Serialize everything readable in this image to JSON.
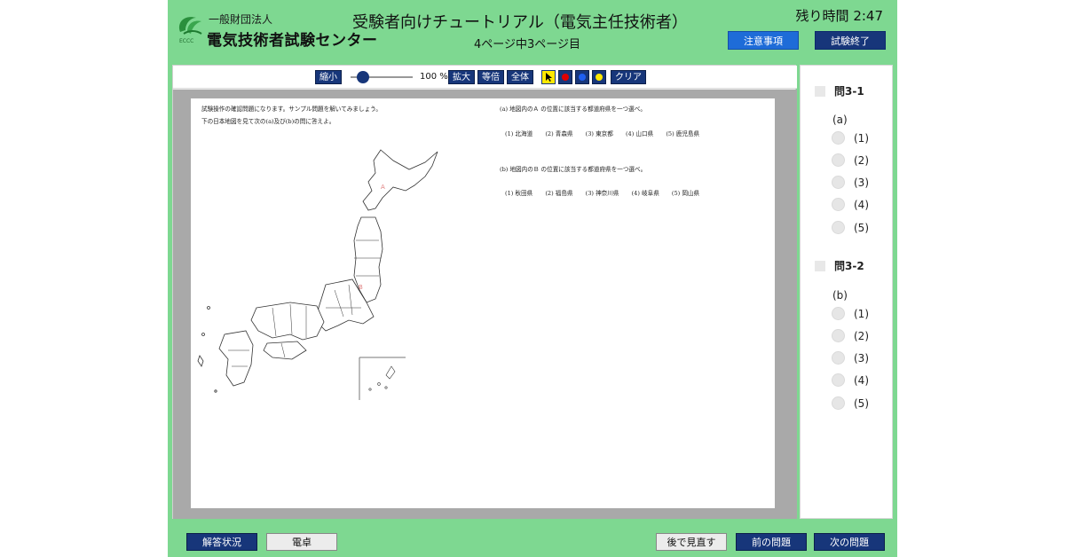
{
  "header": {
    "org_small": "一般財団法人",
    "org_large": "電気技術者試験センター",
    "exam_title": "受験者向けチュートリアル（電気主任技術者）",
    "page_indicator": "4ページ中3ページ目",
    "time_remaining": "残り時間 2:47",
    "notes_button": "注意事項",
    "end_exam_button": "試験終了"
  },
  "toolbar": {
    "zoom_out": "縮小",
    "zoom_value": "100 %",
    "zoom_in": "拡大",
    "actual_size": "等倍",
    "fit_page": "全体",
    "clear": "クリア",
    "zoom_level_fraction": 0.2,
    "pen_colors": [
      "#e00000",
      "#1f5ff0",
      "#ffe800"
    ]
  },
  "document": {
    "intro_line1": "試験操作の確認問題になります。サンプル問題を解いてみましょう。",
    "intro_line2": "下の日本地図を見て次の(a)及び(b)の問に答えよ。",
    "q_a": "(a) 地図内のＡ の位置に該当する都道府県を一つ選べ。",
    "q_a_choices": [
      "(1) 北海道",
      "(2) 青森県",
      "(3) 東京都",
      "(4) 山口県",
      "(5) 鹿児島県"
    ],
    "q_b": "(b) 地図内のＢ の位置に該当する都道府県を一つ選べ。",
    "q_b_choices": [
      "(1) 秋田県",
      "(2) 福島県",
      "(3) 神奈川県",
      "(4) 岐阜県",
      "(5) 岡山県"
    ],
    "map_label_a": "A",
    "map_label_b": "B"
  },
  "answers": {
    "q1_title": "問3-1",
    "q1_sub": "(a)",
    "q1_options": [
      "(1)",
      "(2)",
      "(3)",
      "(4)",
      "(5)"
    ],
    "q2_title": "問3-2",
    "q2_sub": "(b)",
    "q2_options": [
      "(1)",
      "(2)",
      "(3)",
      "(4)",
      "(5)"
    ]
  },
  "footer": {
    "answer_status": "解答状況",
    "calculator": "電卓",
    "review_later": "後で見直す",
    "prev_question": "前の問題",
    "next_question": "次の問題"
  },
  "colors": {
    "frame_green": "#7ed891",
    "button_navy": "#17367a",
    "notes_blue": "#1e6cd8",
    "map_label_red": "#e08080"
  }
}
